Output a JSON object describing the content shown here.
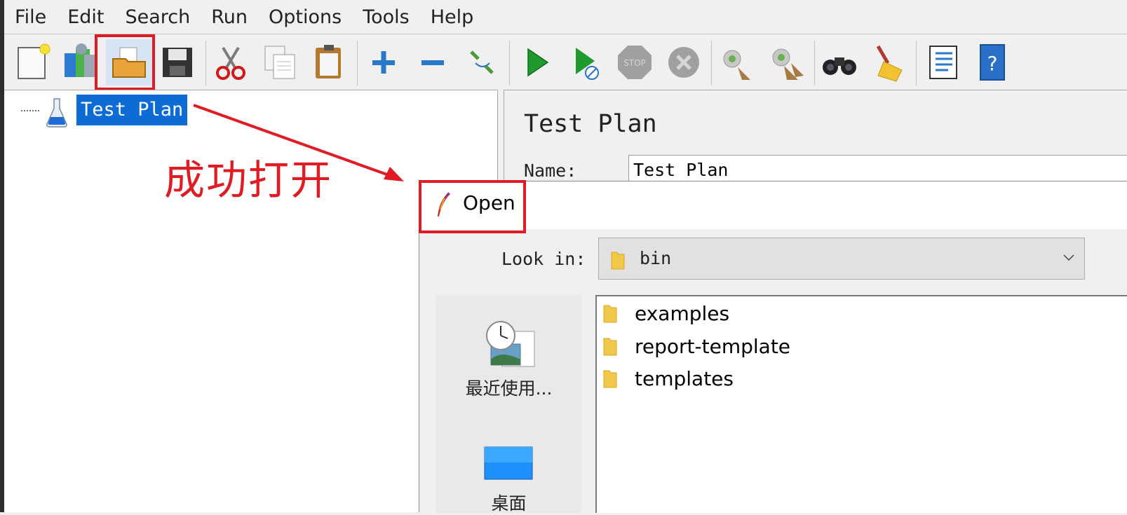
{
  "menu": [
    "File",
    "Edit",
    "Search",
    "Run",
    "Options",
    "Tools",
    "Help"
  ],
  "toolbar": {
    "icons": [
      "new-file-icon",
      "templates-icon",
      "open-folder-icon",
      "save-icon",
      "cut-icon",
      "copy-icon",
      "paste-icon",
      "expand-plus-icon",
      "collapse-minus-icon",
      "toggle-icon",
      "start-icon",
      "start-no-pauses-icon",
      "stop-icon",
      "shutdown-icon",
      "clear-icon",
      "clear-all-icon",
      "search-binoculars-icon",
      "reset-search-broom-icon",
      "function-helper-icon",
      "help-icon"
    ],
    "highlight_color": "#e01b24"
  },
  "tree": {
    "root_label": "Test Plan",
    "selection_color": "#0c6bd4"
  },
  "right_panel": {
    "title": "Test Plan",
    "name_label": "Name:",
    "name_value": "Test Plan"
  },
  "annotation": {
    "text": "成功打开",
    "color": "#e01b24"
  },
  "dialog": {
    "title": "Open",
    "look_in_label": "Look in:",
    "look_in_value": "bin",
    "places": [
      {
        "label": "最近使用...",
        "icon": "recent-clock-icon"
      },
      {
        "label": "桌面",
        "icon": "desktop-icon"
      }
    ],
    "files": [
      {
        "name": "examples",
        "icon": "folder-icon"
      },
      {
        "name": "report-template",
        "icon": "folder-icon"
      },
      {
        "name": "templates",
        "icon": "folder-icon"
      }
    ]
  }
}
